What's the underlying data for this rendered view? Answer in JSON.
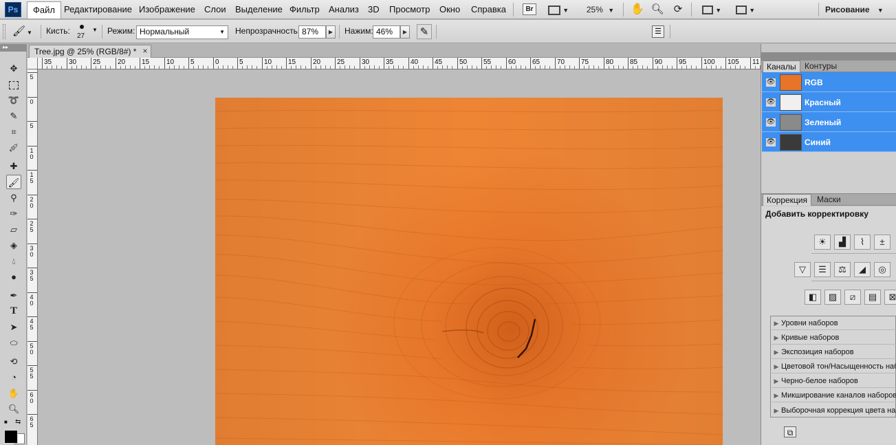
{
  "menubar": {
    "logo": "Ps",
    "menus": [
      "Файл",
      "Редактирование",
      "Изображение",
      "Слои",
      "Выделение",
      "Фильтр",
      "Анализ",
      "3D",
      "Просмотр",
      "Окно",
      "Справка"
    ],
    "bridge_label": "Br",
    "zoom": "25%",
    "workspace": "Рисование"
  },
  "options": {
    "brush_label": "Кисть:",
    "brush_size": "27",
    "mode_label": "Режим:",
    "mode_value": "Нормальный",
    "opacity_label": "Непрозрачность:",
    "opacity_value": "87%",
    "flow_label": "Нажим:",
    "flow_value": "46%"
  },
  "document": {
    "tab_title": "Tree.jpg @ 25% (RGB/8#) *",
    "close": "×"
  },
  "rulers": {
    "h_labels": [
      "35",
      "30",
      "25",
      "20",
      "15",
      "10",
      "5",
      "0",
      "5",
      "10",
      "15",
      "20",
      "25",
      "30",
      "35",
      "40",
      "45",
      "50",
      "55",
      "60",
      "65",
      "70",
      "75",
      "80",
      "85",
      "90",
      "95",
      "100",
      "105",
      "11"
    ],
    "v_labels": [
      "5",
      "0",
      "5",
      "1 0",
      "1 5",
      "2 0",
      "2 5",
      "3 0",
      "3 5",
      "4 0",
      "4 5",
      "5 0",
      "5 5",
      "6 0",
      "6 5"
    ]
  },
  "channels_panel": {
    "tabs": [
      "Каналы",
      "Контуры"
    ],
    "active_tab": "Каналы",
    "channels": [
      {
        "name": "RGB",
        "thumb_color": "#e8742a"
      },
      {
        "name": "Красный",
        "thumb_color": "#f0f0f0"
      },
      {
        "name": "Зеленый",
        "thumb_color": "#8a8a8a"
      },
      {
        "name": "Синий",
        "thumb_color": "#3a3a3a"
      }
    ]
  },
  "adjustments_panel": {
    "tabs": [
      "Коррекция",
      "Маски"
    ],
    "active_tab": "Коррекция",
    "heading": "Добавить корректировку",
    "presets": [
      "Уровни наборов",
      "Кривые наборов",
      "Экспозиция наборов",
      "Цветовой тон/Насыщенность наборов",
      "Черно-белое наборов",
      "Микширование каналов наборов",
      "Выборочная коррекция цвета наборов"
    ]
  },
  "colors": {
    "accent": "#3d8ff0",
    "wood": "#e8782a",
    "foreground": "#000000",
    "background": "#ffffff"
  }
}
